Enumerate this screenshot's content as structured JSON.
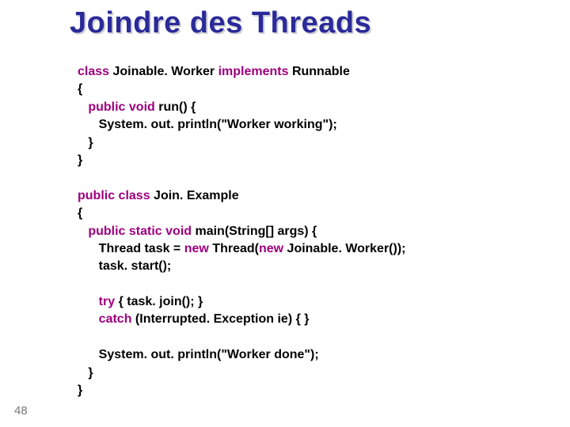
{
  "title": "Joindre des Threads",
  "page_number": "48",
  "kw": {
    "class": "class",
    "implements": "implements",
    "public_void": "public void",
    "public_class": "public class",
    "public_static_void": "public static void",
    "new1": "new",
    "new2": "new",
    "try": "try",
    "catch": "catch"
  },
  "txt": {
    "l1a": " Joinable. Worker ",
    "l1b": " Runnable",
    "l2": "{",
    "l3": " run() {",
    "l4": "      System. out. println(\"Worker working\");",
    "l5": "   }",
    "l6": "}",
    "l8": " Join. Example",
    "l9": "{",
    "l10": " main(String[] args) {",
    "l11a": "      Thread task = ",
    "l11b": " Thread(",
    "l11c": " Joinable. Worker());",
    "l12": "      task. start();",
    "l14": " { task. join(); }",
    "l15a": " (Interrupted",
    "l15b": ". ",
    "l15c": "Exception ie) { }",
    "l17": "      System. out. println(\"Worker done\");",
    "l18": "   }",
    "l19": "}"
  }
}
